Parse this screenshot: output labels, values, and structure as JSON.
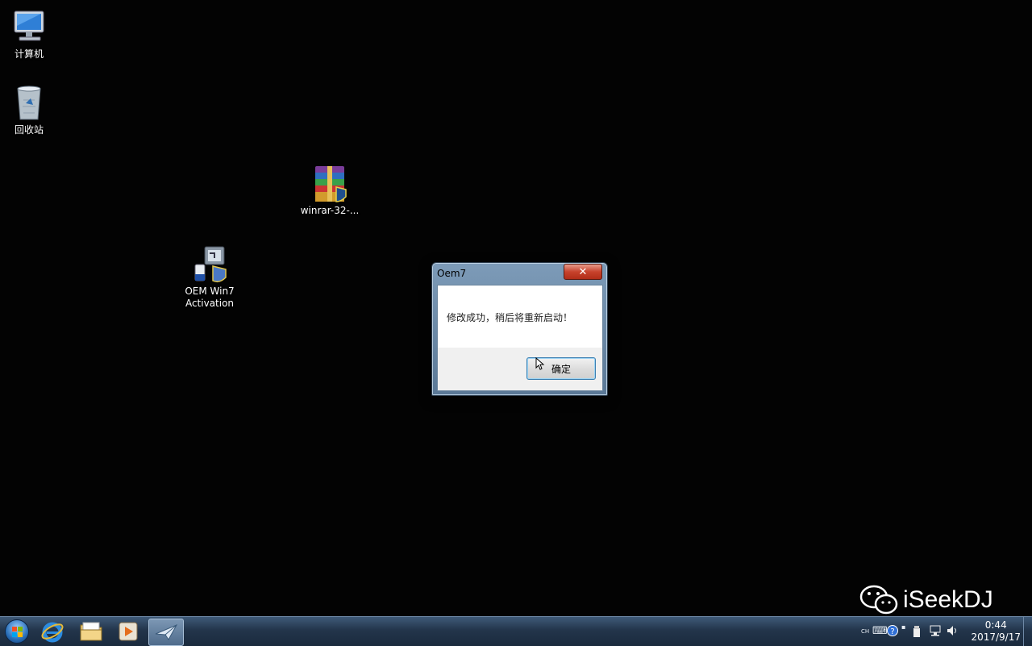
{
  "desktop_icons": [
    {
      "name": "computer",
      "label": "计算机",
      "icon": "computer-icon"
    },
    {
      "name": "recycle-bin",
      "label": "回收站",
      "icon": "recycle-bin-icon"
    },
    {
      "name": "winrar",
      "label": "winrar-32-...",
      "icon": "winrar-icon"
    },
    {
      "name": "oem-win7",
      "label": "OEM Win7\nActivation",
      "icon": "oem-activation-icon"
    }
  ],
  "dialog": {
    "title": "Oem7",
    "close_label": "✕",
    "message": "修改成功，稍后将重新启动！",
    "ok_label": "确定"
  },
  "taskbar": {
    "items": [
      "start-button",
      "internet-explorer",
      "windows-explorer",
      "media-player",
      "oem-app"
    ],
    "clock_time": "0:44",
    "clock_date": "2017/9/17",
    "lang_indicator": "CH"
  },
  "watermark": {
    "text": "iSeekDJ"
  },
  "colors": {
    "accent": "#3c7fb1",
    "close": "#c7422c",
    "taskbar": "#23354b"
  }
}
